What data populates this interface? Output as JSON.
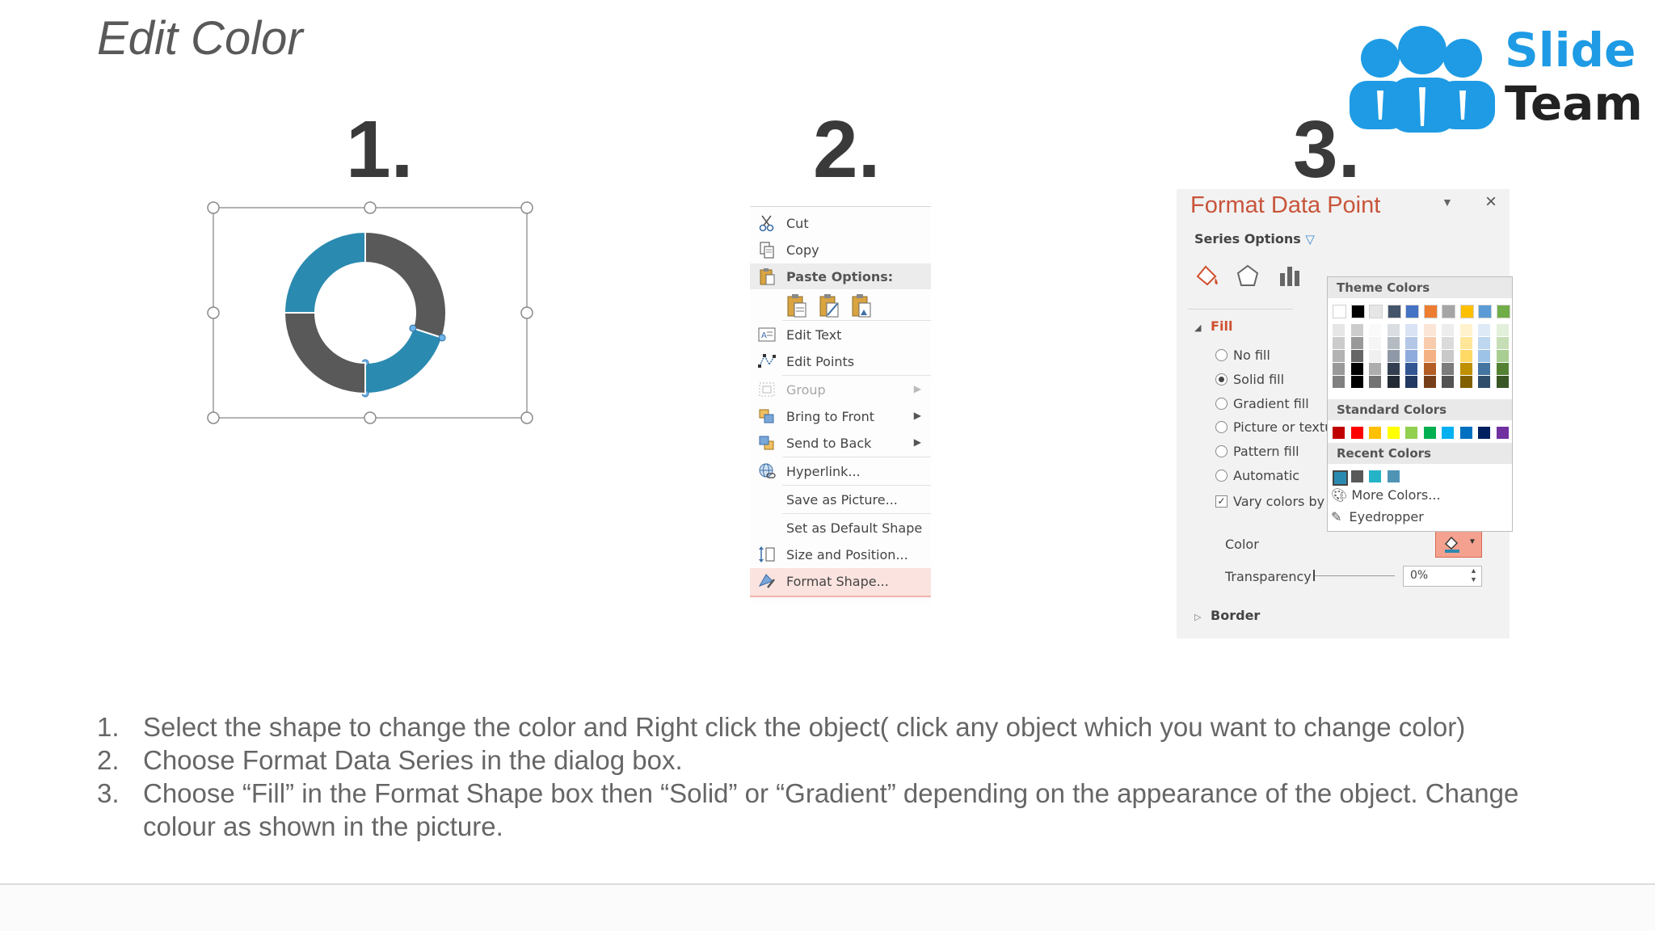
{
  "slide": {
    "title": "Edit Color"
  },
  "logo": {
    "line1": "Slide",
    "line2": "Team"
  },
  "steps": [
    "1.",
    "2.",
    "3."
  ],
  "chart_data": {
    "type": "pie",
    "title": "",
    "values": [
      30,
      20,
      25,
      25
    ],
    "colors": [
      "#595959",
      "#2b8ab0",
      "#595959",
      "#2b8ab0"
    ]
  },
  "context_menu": {
    "items": [
      {
        "label": "Cut",
        "icon": "scissors-icon"
      },
      {
        "label": "Copy",
        "icon": "copy-icon"
      },
      {
        "label": "Paste Options:",
        "icon": "paste-icon"
      },
      {
        "label": "Edit Text",
        "icon": "edit-text-icon"
      },
      {
        "label": "Edit Points",
        "icon": "edit-points-icon"
      },
      {
        "label": "Group",
        "icon": "group-icon"
      },
      {
        "label": "Bring to Front",
        "icon": "bring-to-front-icon"
      },
      {
        "label": "Send to Back",
        "icon": "send-to-back-icon"
      },
      {
        "label": "Hyperlink...",
        "icon": "hyperlink-icon"
      },
      {
        "label": "Save as Picture...",
        "icon": ""
      },
      {
        "label": "Set as Default Shape",
        "icon": ""
      },
      {
        "label": "Size and Position...",
        "icon": "size-position-icon"
      },
      {
        "label": "Format Shape...",
        "icon": "format-shape-icon"
      }
    ]
  },
  "format_panel": {
    "title": "Format Data Point",
    "series_options": "Series Options",
    "fill_header": "Fill",
    "fill_options": [
      "No fill",
      "Solid fill",
      "Gradient fill",
      "Picture or textur",
      "Pattern fill",
      "Automatic"
    ],
    "selected_fill": "Solid fill",
    "vary_colors": "Vary colors by sl",
    "color_label": "Color",
    "transparency_label": "Transparency",
    "transparency_value": "0%",
    "border_header": "Border",
    "popup": {
      "theme_colors": "Theme Colors",
      "standard_colors": "Standard Colors",
      "recent_colors": "Recent Colors",
      "more_colors": "More Colors...",
      "eyedropper": "Eyedropper",
      "theme_top": [
        "#ffffff",
        "#000000",
        "#e7e6e6",
        "#44546a",
        "#4472c4",
        "#ed7d31",
        "#a5a5a5",
        "#ffc000",
        "#5b9bd5",
        "#70ad47"
      ],
      "standard": [
        "#c00000",
        "#ff0000",
        "#ffc000",
        "#ffff00",
        "#92d050",
        "#00b050",
        "#00b0f0",
        "#0070c0",
        "#002060",
        "#7030a0"
      ],
      "recent": [
        "#2b8ab0",
        "#595959",
        "#25b3c8",
        "#4f94b5"
      ]
    }
  },
  "instructions": [
    {
      "num": "1.",
      "text": "Select the shape to change the color and Right click the object( click any object which you want to change color)"
    },
    {
      "num": "2.",
      "text": "Choose Format Data Series in the dialog box."
    },
    {
      "num": "3.",
      "text": "Choose “Fill” in the Format Shape box then “Solid” or “Gradient” depending on the appearance of the object. Change"
    },
    {
      "num": "",
      "text": "colour as shown in the picture."
    }
  ]
}
